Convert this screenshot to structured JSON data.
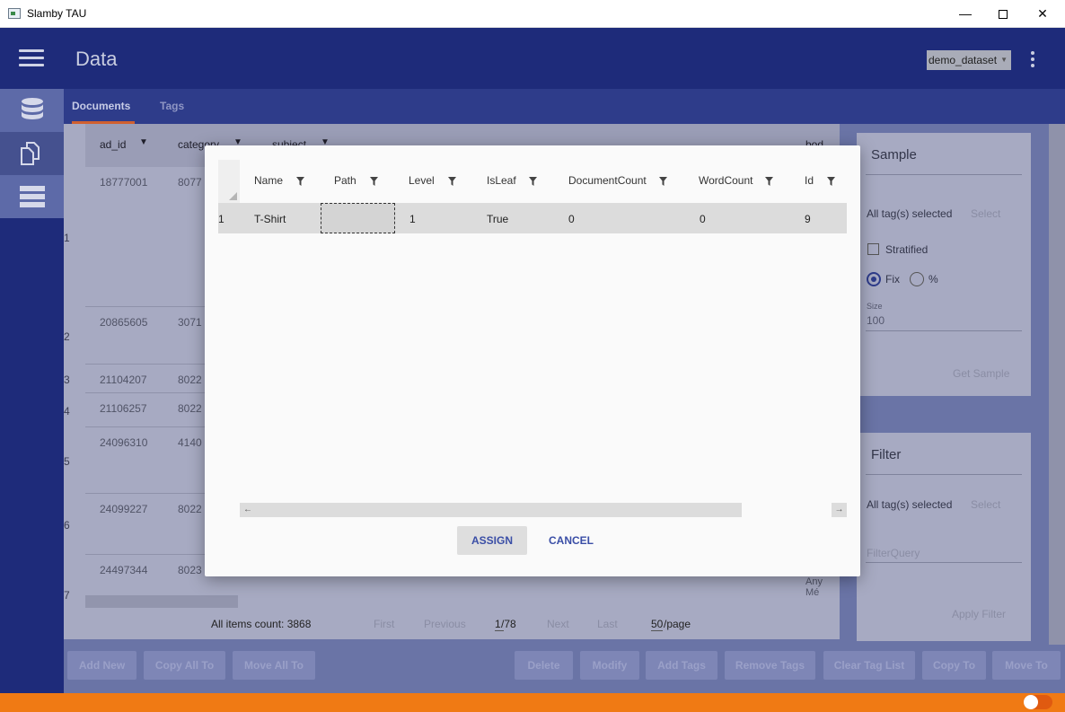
{
  "window": {
    "title": "Slamby TAU",
    "minimize": "—",
    "close": "✕"
  },
  "header": {
    "title": "Data",
    "dataset": "demo_dataset"
  },
  "tabs": [
    {
      "label": "Documents"
    },
    {
      "label": "Tags"
    }
  ],
  "documents": {
    "columns": [
      "ad_id",
      "category",
      "subject",
      "bod"
    ],
    "rows": [
      {
        "num": "1",
        "ad_id": "18777001",
        "category": "8077"
      },
      {
        "num": "2",
        "ad_id": "20865605",
        "category": "3071"
      },
      {
        "num": "3",
        "ad_id": "21104207",
        "category": "8022"
      },
      {
        "num": "4",
        "ad_id": "21106257",
        "category": "8022"
      },
      {
        "num": "5",
        "ad_id": "24096310",
        "category": "4140"
      },
      {
        "num": "6",
        "ad_id": "24099227",
        "category": "8022"
      },
      {
        "num": "7",
        "ad_id": "24497344",
        "category": "8023"
      }
    ],
    "cell_peek": [
      "Any",
      "Mé"
    ],
    "footer": {
      "count_label": "All items count: 3868",
      "first": "First",
      "previous": "Previous",
      "page": "1",
      "pages": "/78",
      "next": "Next",
      "last": "Last",
      "page_size": "50",
      "per_page": "/page"
    }
  },
  "sample": {
    "title": "Sample",
    "tags_selected": "All tag(s) selected",
    "select": "Select",
    "stratified": "Stratified",
    "fix": "Fix",
    "percent": "%",
    "size_label": "Size",
    "size_value": "100",
    "get_sample": "Get Sample"
  },
  "filter": {
    "title": "Filter",
    "tags_selected": "All tag(s) selected",
    "select": "Select",
    "query_placeholder": "FilterQuery",
    "apply": "Apply Filter"
  },
  "actions": {
    "add_new": "Add New",
    "copy_all_to": "Copy All To",
    "move_all_to": "Move All To",
    "delete": "Delete",
    "modify": "Modify",
    "add_tags": "Add Tags",
    "remove_tags": "Remove Tags",
    "clear_tag_list": "Clear Tag List",
    "copy_to": "Copy To",
    "move_to": "Move To"
  },
  "modal": {
    "columns": [
      "Name",
      "Path",
      "Level",
      "IsLeaf",
      "DocumentCount",
      "WordCount",
      "Id"
    ],
    "row": {
      "num": "1",
      "name": "T-Shirt",
      "path": "",
      "level": "1",
      "isleaf": "True",
      "doccount": "0",
      "wordcount": "0",
      "id": "9"
    },
    "assign": "ASSIGN",
    "cancel": "CANCEL",
    "scroll_left": "←",
    "scroll_right": "→"
  },
  "colors": {
    "header": "#1e2b7a",
    "accent": "#f07a14",
    "primary_text": "#3a4ea6"
  }
}
